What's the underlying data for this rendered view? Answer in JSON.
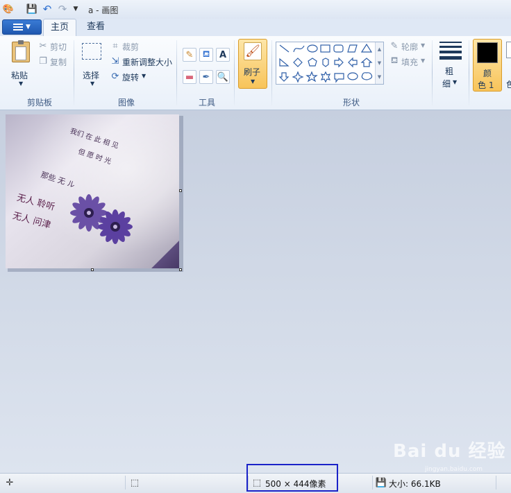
{
  "title_bar": {
    "title": "a - 画图"
  },
  "tabs": [
    {
      "label": "主页"
    },
    {
      "label": "查看"
    }
  ],
  "ribbon": {
    "clipboard": {
      "paste": "粘贴",
      "cut": "剪切",
      "copy": "复制",
      "group": "剪贴板"
    },
    "image": {
      "select": "选择",
      "crop": "裁剪",
      "resize": "重新调整大小",
      "rotate": "旋转",
      "group": "图像"
    },
    "tools": {
      "group": "工具",
      "text_glyph": "A"
    },
    "brush": {
      "label": "刷子"
    },
    "shapes": {
      "outline": "轮廓",
      "fill": "填充",
      "group": "形状"
    },
    "size": {
      "label_line1": "粗",
      "label_line2": "细"
    },
    "colors": {
      "color1_line1": "颜",
      "color1_line2": "色 1",
      "color1_value": "#000000",
      "color2_partial": "色"
    }
  },
  "canvas": {
    "handwriting": [
      "无人 聆听",
      "无人 问津",
      "那些 无 ル",
      "我们 在 此 相 见",
      "但 愿 时 光"
    ]
  },
  "status_bar": {
    "image_size": "500 × 444像素",
    "file_size": "大小: 66.1KB"
  },
  "watermark": {
    "text": "Bai du 经验",
    "sub": "jingyan.baidu.com"
  },
  "colors": {
    "ribbon_accent": "#f8c45a",
    "selection_frame": "#1a22c8",
    "app_button": "#1f58b0"
  }
}
